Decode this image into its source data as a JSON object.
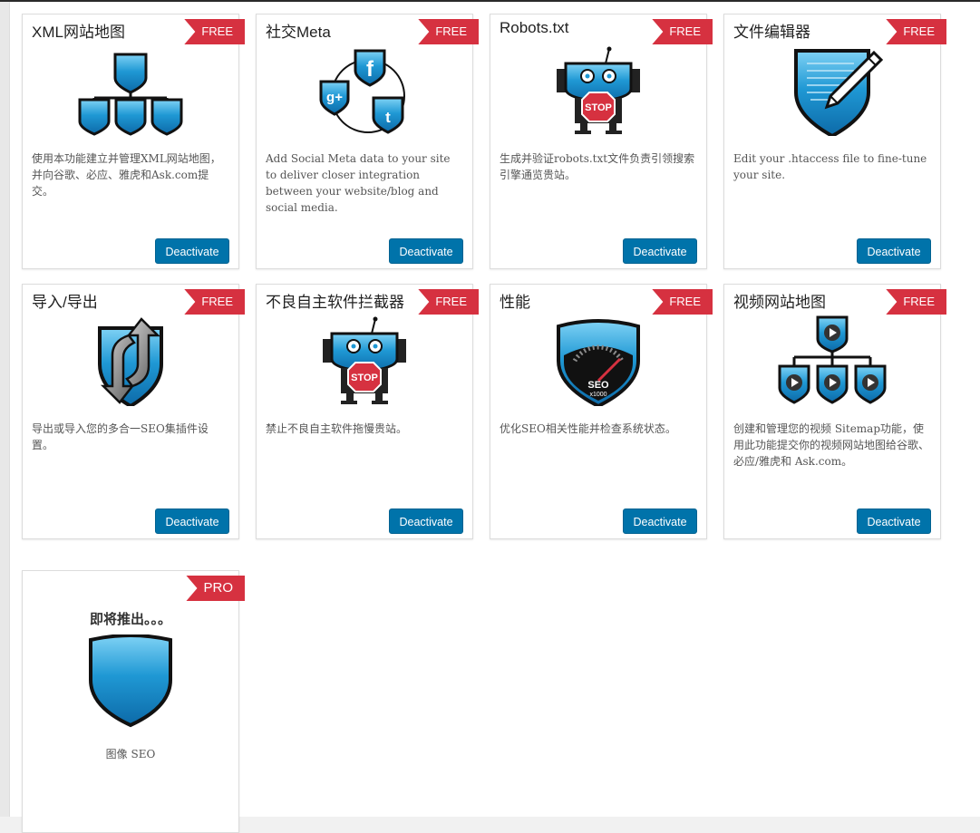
{
  "colors": {
    "accent_button": "#0073aa",
    "ribbon": "#d63140",
    "shield_blue": "#1f98d4",
    "stroke": "#111111"
  },
  "cards": [
    {
      "title": "XML网站地图",
      "badge": "FREE",
      "icon": "sitemap-icon",
      "description": "使用本功能建立并管理XML网站地图，并向谷歌、必应、雅虎和Ask.com提交。",
      "button_label": "Deactivate"
    },
    {
      "title": "社交Meta",
      "badge": "FREE",
      "icon": "social-meta-icon",
      "description": "Add Social Meta data to your site to deliver closer integration between your website/blog and social media.",
      "button_label": "Deactivate"
    },
    {
      "title": "Robots.txt",
      "badge": "FREE",
      "icon": "robot-stop-icon",
      "description": "生成并验证robots.txt文件负责引领搜索引擎通览贵站。",
      "button_label": "Deactivate"
    },
    {
      "title": "文件编辑器",
      "badge": "FREE",
      "icon": "file-editor-icon",
      "description": "Edit your .htaccess file to fine-tune your site.",
      "button_label": "Deactivate"
    },
    {
      "title": "导入/导出",
      "badge": "FREE",
      "icon": "import-export-icon",
      "description": "导出或导入您的多合一SEO集插件设置。",
      "button_label": "Deactivate"
    },
    {
      "title": "不良自主软件拦截器",
      "badge": "FREE",
      "icon": "bad-bot-blocker-icon",
      "description": "禁止不良自主软件拖慢贵站。",
      "button_label": "Deactivate"
    },
    {
      "title": "性能",
      "badge": "FREE",
      "icon": "performance-gauge-icon",
      "icon_text_top": "SEO",
      "icon_text_bottom": "x1000",
      "description": "优化SEO相关性能并检查系统状态。",
      "button_label": "Deactivate"
    },
    {
      "title": "视频网站地图",
      "badge": "FREE",
      "icon": "video-sitemap-icon",
      "description": "创建和管理您的视频 Sitemap功能，使用此功能提交你的视频网站地图给谷歌、必应/雅虎和 Ask.com。",
      "button_label": "Deactivate"
    }
  ],
  "coming_soon": {
    "title": "即将推出。。。",
    "badge": "PRO",
    "icon": "shield-icon",
    "description": "图像 SEO"
  }
}
